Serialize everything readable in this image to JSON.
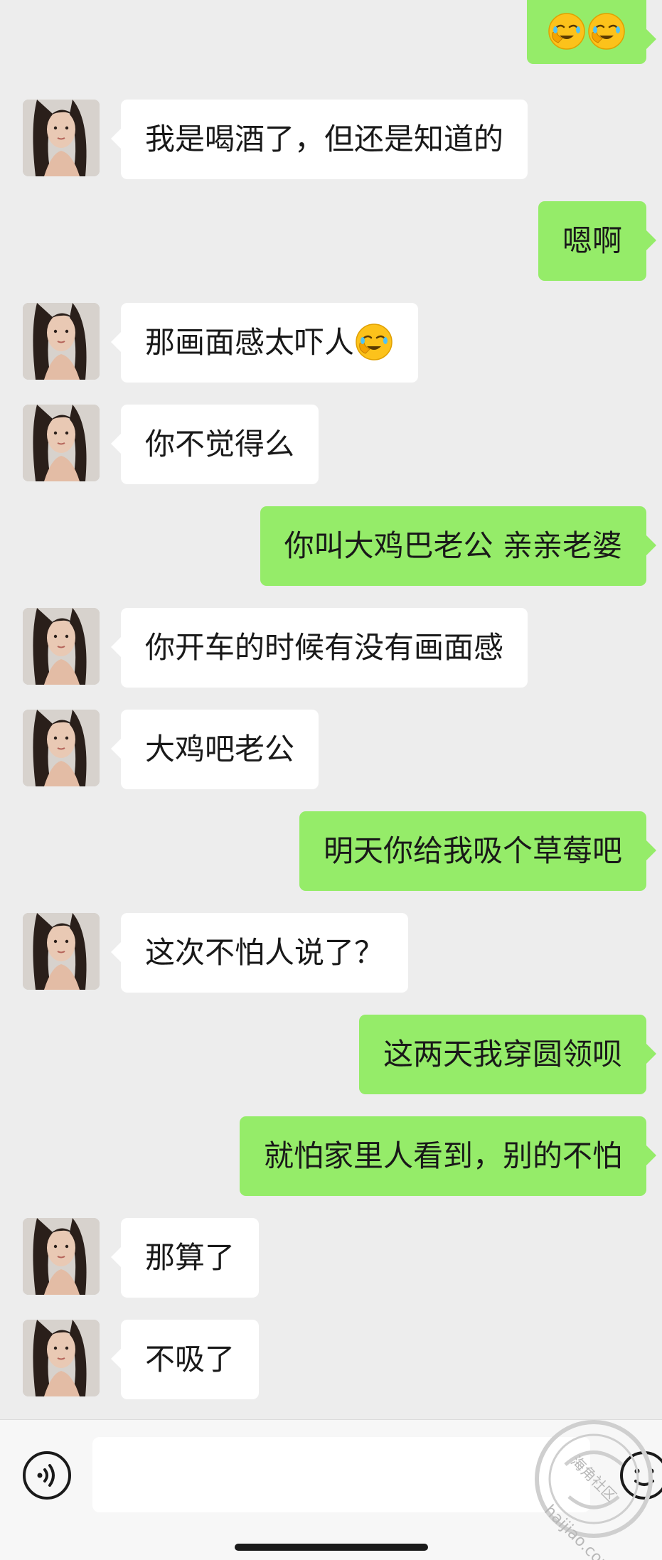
{
  "colors": {
    "background": "#ededed",
    "incoming_bubble": "#ffffff",
    "outgoing_bubble": "#95ec69",
    "text": "#191919",
    "input_bar": "#f7f7f7"
  },
  "messages": [
    {
      "side": "out",
      "text": "",
      "emojis": [
        "facepalm-emoji",
        "facepalm-emoji"
      ]
    },
    {
      "side": "in",
      "text": "我是喝酒了，但还是知道的"
    },
    {
      "side": "out",
      "text": "嗯啊"
    },
    {
      "side": "in",
      "text": "那画面感太吓人",
      "emojis": [
        "facepalm-emoji"
      ]
    },
    {
      "side": "in",
      "text": "你不觉得么"
    },
    {
      "side": "out",
      "text": "你叫大鸡巴老公 亲亲老婆"
    },
    {
      "side": "in",
      "text": "你开车的时候有没有画面感"
    },
    {
      "side": "in",
      "text": "大鸡吧老公"
    },
    {
      "side": "out",
      "text": "明天你给我吸个草莓吧"
    },
    {
      "side": "in",
      "text": "这次不怕人说了？"
    },
    {
      "side": "out",
      "text": "这两天我穿圆领呗"
    },
    {
      "side": "out",
      "text": "就怕家里人看到，别的不怕"
    },
    {
      "side": "in",
      "text": "那算了"
    },
    {
      "side": "in",
      "text": "不吸了"
    }
  ],
  "input_bar": {
    "voice_icon": "voice-icon",
    "emoji_icon": "emoji-icon",
    "message_value": ""
  },
  "watermark": {
    "brand": "海角社区",
    "site": "haijiao.com"
  }
}
